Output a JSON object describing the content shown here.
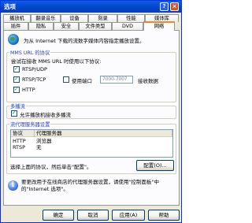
{
  "window": {
    "title": "选项",
    "help_glyph": "?",
    "close_glyph": "×"
  },
  "tabs_row1": [
    "播放机",
    "翻录音乐",
    "设备",
    "刻录",
    "性能",
    "媒体库"
  ],
  "tabs_row2": [
    "插件",
    "隐私",
    "安全",
    "文件类型",
    "DVD",
    "网络"
  ],
  "active_tab": "网络",
  "intro": "为从 Internet 下载的流数字媒体内容指定播放设置。",
  "protocols": {
    "legend": "MMS URL 的协议",
    "description": "尝试在接收 MMS URL 时使用以下协议:",
    "items": [
      {
        "label": "RTSP/UDP",
        "checked": true
      },
      {
        "label": "RTSP/TCP",
        "checked": true
      },
      {
        "label": "HTTP",
        "checked": true
      }
    ],
    "use_ports_label": "使用端口",
    "use_ports_checked": false,
    "ports_placeholder": "7000-7007",
    "receive_data_label": "接收数据"
  },
  "multicast": {
    "legend": "多播流",
    "allow_label": "允许播放机接收多播流",
    "allow_checked": true
  },
  "proxy": {
    "legend": "流代理服务器设置",
    "columns": [
      "协议",
      "代理服务器"
    ],
    "rows": [
      {
        "protocol": "HTTP",
        "server": "浏览器"
      },
      {
        "protocol": "RTSP",
        "server": "无"
      }
    ],
    "instruction": "选择上面的协议，然后单击\"配置\"。",
    "configure_label": "配置(O)..."
  },
  "info_text": "要更改用于在线商店的代理服务器设置，请使用\"控制面板\"中的\"Internet 选项\"。",
  "buttons": {
    "ok": "确定",
    "cancel": "取消",
    "apply": "应用(A)",
    "help": "帮助"
  }
}
